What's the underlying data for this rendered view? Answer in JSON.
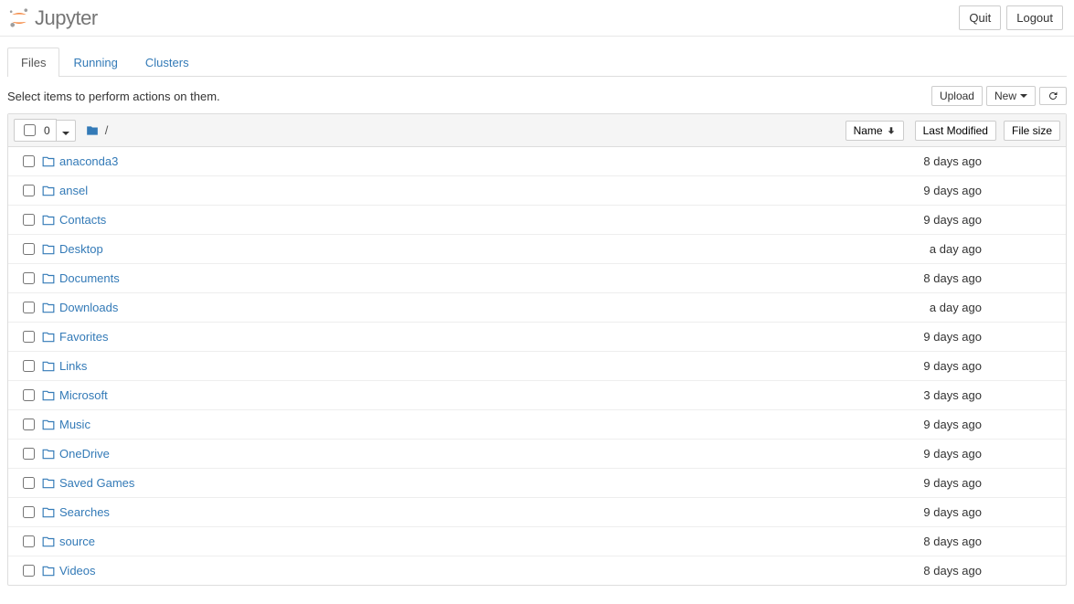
{
  "header": {
    "logo_text": "Jupyter",
    "quit_label": "Quit",
    "logout_label": "Logout"
  },
  "tabs": {
    "files": "Files",
    "running": "Running",
    "clusters": "Clusters",
    "active": "files"
  },
  "toolbar": {
    "hint": "Select items to perform actions on them.",
    "upload_label": "Upload",
    "new_label": "New"
  },
  "list_header": {
    "select_count": "0",
    "breadcrumb_root": "/",
    "name_label": "Name",
    "last_modified_label": "Last Modified",
    "file_size_label": "File size"
  },
  "items": [
    {
      "name": "anaconda3",
      "modified": "8 days ago",
      "size": ""
    },
    {
      "name": "ansel",
      "modified": "9 days ago",
      "size": ""
    },
    {
      "name": "Contacts",
      "modified": "9 days ago",
      "size": ""
    },
    {
      "name": "Desktop",
      "modified": "a day ago",
      "size": ""
    },
    {
      "name": "Documents",
      "modified": "8 days ago",
      "size": ""
    },
    {
      "name": "Downloads",
      "modified": "a day ago",
      "size": ""
    },
    {
      "name": "Favorites",
      "modified": "9 days ago",
      "size": ""
    },
    {
      "name": "Links",
      "modified": "9 days ago",
      "size": ""
    },
    {
      "name": "Microsoft",
      "modified": "3 days ago",
      "size": ""
    },
    {
      "name": "Music",
      "modified": "9 days ago",
      "size": ""
    },
    {
      "name": "OneDrive",
      "modified": "9 days ago",
      "size": ""
    },
    {
      "name": "Saved Games",
      "modified": "9 days ago",
      "size": ""
    },
    {
      "name": "Searches",
      "modified": "9 days ago",
      "size": ""
    },
    {
      "name": "source",
      "modified": "8 days ago",
      "size": ""
    },
    {
      "name": "Videos",
      "modified": "8 days ago",
      "size": ""
    }
  ]
}
